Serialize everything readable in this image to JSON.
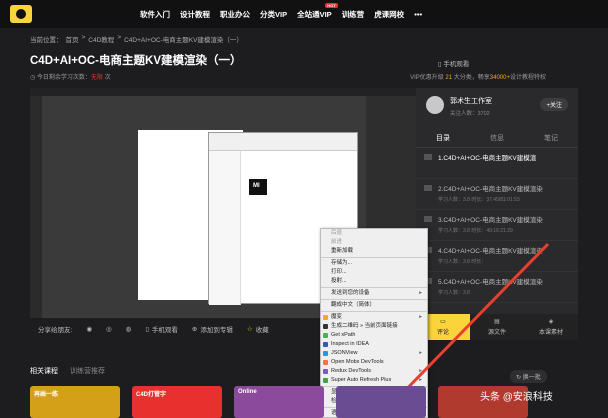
{
  "nav": {
    "items": [
      "软件入门",
      "设计教程",
      "职业办公",
      "分类VIP",
      "全站通VIP",
      "训练营",
      "虎课网校",
      "•••"
    ],
    "hot_badge": "HOT"
  },
  "breadcrumb": [
    "当前位置：",
    "首页",
    ">",
    "C4D教程",
    ">",
    "C4D+AI+OC-电商主题KV建模渲染（一）"
  ],
  "page": {
    "title": "C4D+AI+OC-电商主题KV建模渲染（一）",
    "study_prefix": "今日剩余学习次数：",
    "study_count": "无限",
    "study_suffix": "次",
    "mobile": "手机观看",
    "vip_prefix": "VIP优惠升级 ",
    "vip_count": "21",
    "vip_middle": " 大分类，畅享",
    "vip_total": "34000+",
    "vip_suffix": "设计教程特权"
  },
  "player": {
    "explorer_logo": "MI",
    "toolbar": {
      "share": "分享给朋友:",
      "mobile": "手机观看",
      "playlist": "添加到专辑",
      "favorite": "收藏"
    }
  },
  "panel": {
    "teacher": "郭术生工作室",
    "stats": "关注人数：3702",
    "follow": "+关注",
    "tabs": [
      "目录",
      "信息",
      "笔记"
    ],
    "lessons": [
      {
        "title": "1.C4D+AI+OC-电商主题KV建模渲",
        "meta": ""
      },
      {
        "title": "2.C4D+AI+OC-电商主题KV建模渲染",
        "meta": "学习人数：3.8   时长：37:45/81:01:53"
      },
      {
        "title": "3.C4D+AI+OC-电商主题KV建模渲染",
        "meta": "学习人数：3.8   时长：49:16:21:29"
      },
      {
        "title": "4.C4D+AI+OC-电商主题KV建模渲染",
        "meta": "学习人数：3.8   时长："
      },
      {
        "title": "5.C4D+AI+OC-电商主题KV建模渲染",
        "meta": "学习人数：3.8"
      }
    ],
    "bottom": [
      "评论",
      "源文件",
      "本课素材"
    ]
  },
  "context_menu": {
    "items": [
      {
        "label": "后退",
        "dim": true
      },
      {
        "label": "前进",
        "dim": true
      },
      {
        "label": "重新加载",
        "dim": false
      },
      {
        "sep": true
      },
      {
        "label": "存储为...",
        "dim": false
      },
      {
        "label": "打印...",
        "dim": false
      },
      {
        "label": "投射...",
        "dim": false
      },
      {
        "sep": true
      },
      {
        "label": "发送到您的设备",
        "dim": false,
        "sub": true
      },
      {
        "sep": true
      },
      {
        "label": "翻成中文（简体）",
        "dim": false
      },
      {
        "sep": true
      },
      {
        "label": "魔变",
        "dim": false,
        "sub": true,
        "icon": "#f5a623"
      },
      {
        "label": "生成二维码 » 当前页面链接",
        "dim": false,
        "icon": "#333"
      },
      {
        "label": "Get xPath",
        "dim": false,
        "icon": "#4caf50"
      },
      {
        "label": "Inspect in IDEA",
        "dim": false,
        "icon": "#3f51b5"
      },
      {
        "label": "JSONView",
        "dim": false,
        "sub": true,
        "icon": "#2196f3"
      },
      {
        "label": "Open Mobx DevTools",
        "dim": false,
        "icon": "#ff7043"
      },
      {
        "label": "Redux DevTools",
        "dim": false,
        "sub": true,
        "icon": "#7e57c2"
      },
      {
        "label": "Super Auto Refresh Plus",
        "dim": false,
        "sub": true,
        "icon": "#43a047"
      },
      {
        "sep": true
      },
      {
        "label": "显示网页源代码",
        "dim": false
      },
      {
        "label": "检查",
        "dim": false
      },
      {
        "sep": true
      },
      {
        "label": "语音",
        "dim": false,
        "sub": true
      }
    ]
  },
  "related": {
    "tab_active": "相关课程",
    "tab_other": "训练营推荐",
    "refresh": "换一批",
    "thumbs": [
      {
        "label": "再画一练",
        "color": "#d4a017"
      },
      {
        "label": "C4D打管字",
        "color": "#e8312f"
      },
      {
        "label": "Online",
        "color": "#8b4a9c"
      },
      {
        "label": "",
        "color": "#6a4c93"
      },
      {
        "label": "",
        "color": "#b03a2e"
      }
    ]
  },
  "watermark": "头条 @安浪科技",
  "colors": {
    "accent": "#fbd33b",
    "red": "#e8312f",
    "bg": "#1d1d1f"
  }
}
